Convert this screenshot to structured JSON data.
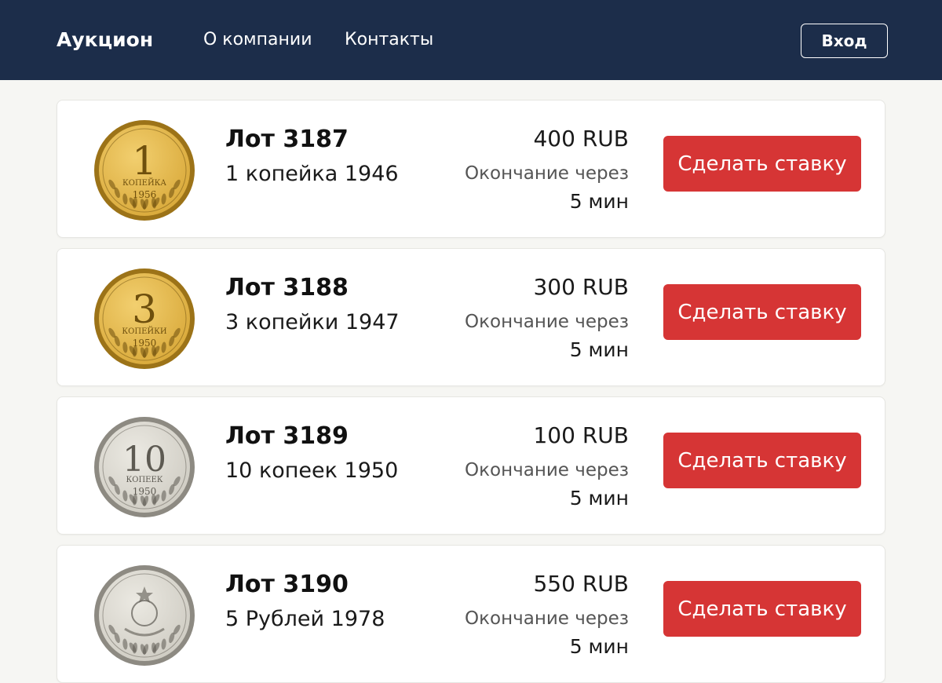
{
  "header": {
    "brand": "Аукцион",
    "nav": [
      "О компании",
      "Контакты"
    ],
    "login_label": "Вход"
  },
  "colors": {
    "header_bg": "#1c2d4a",
    "bid_button": "#d63535",
    "page_bg": "#f6f6f3"
  },
  "lots": [
    {
      "title": "Лот 3187",
      "name": "1 копейка 1946",
      "price": "400 RUB",
      "ends_label": "Окончание через",
      "time_left": "5 мин",
      "bid_label": "Сделать ставку",
      "coin": {
        "metal": "gold",
        "denomination": "1",
        "word": "КОПЕЙКА",
        "year": "1956"
      }
    },
    {
      "title": "Лот 3188",
      "name": "3 копейки 1947",
      "price": "300 RUB",
      "ends_label": "Окончание через",
      "time_left": "5 мин",
      "bid_label": "Сделать ставку",
      "coin": {
        "metal": "gold",
        "denomination": "3",
        "word": "КОПЕЙКИ",
        "year": "1950"
      }
    },
    {
      "title": "Лот 3189",
      "name": "10 копеек  1950",
      "price": "100 RUB",
      "ends_label": "Окончание через",
      "time_left": "5 мин",
      "bid_label": "Сделать ставку",
      "coin": {
        "metal": "silver",
        "denomination": "10",
        "word": "КОПЕЕК",
        "year": "1950"
      }
    },
    {
      "title": "Лот 3190",
      "name": "5 Рублей 1978",
      "price": "550 RUB",
      "ends_label": "Окончание через",
      "time_left": "5 мин",
      "bid_label": "Сделать ставку",
      "coin": {
        "metal": "silver",
        "denomination": "",
        "word": "",
        "year": ""
      }
    }
  ]
}
